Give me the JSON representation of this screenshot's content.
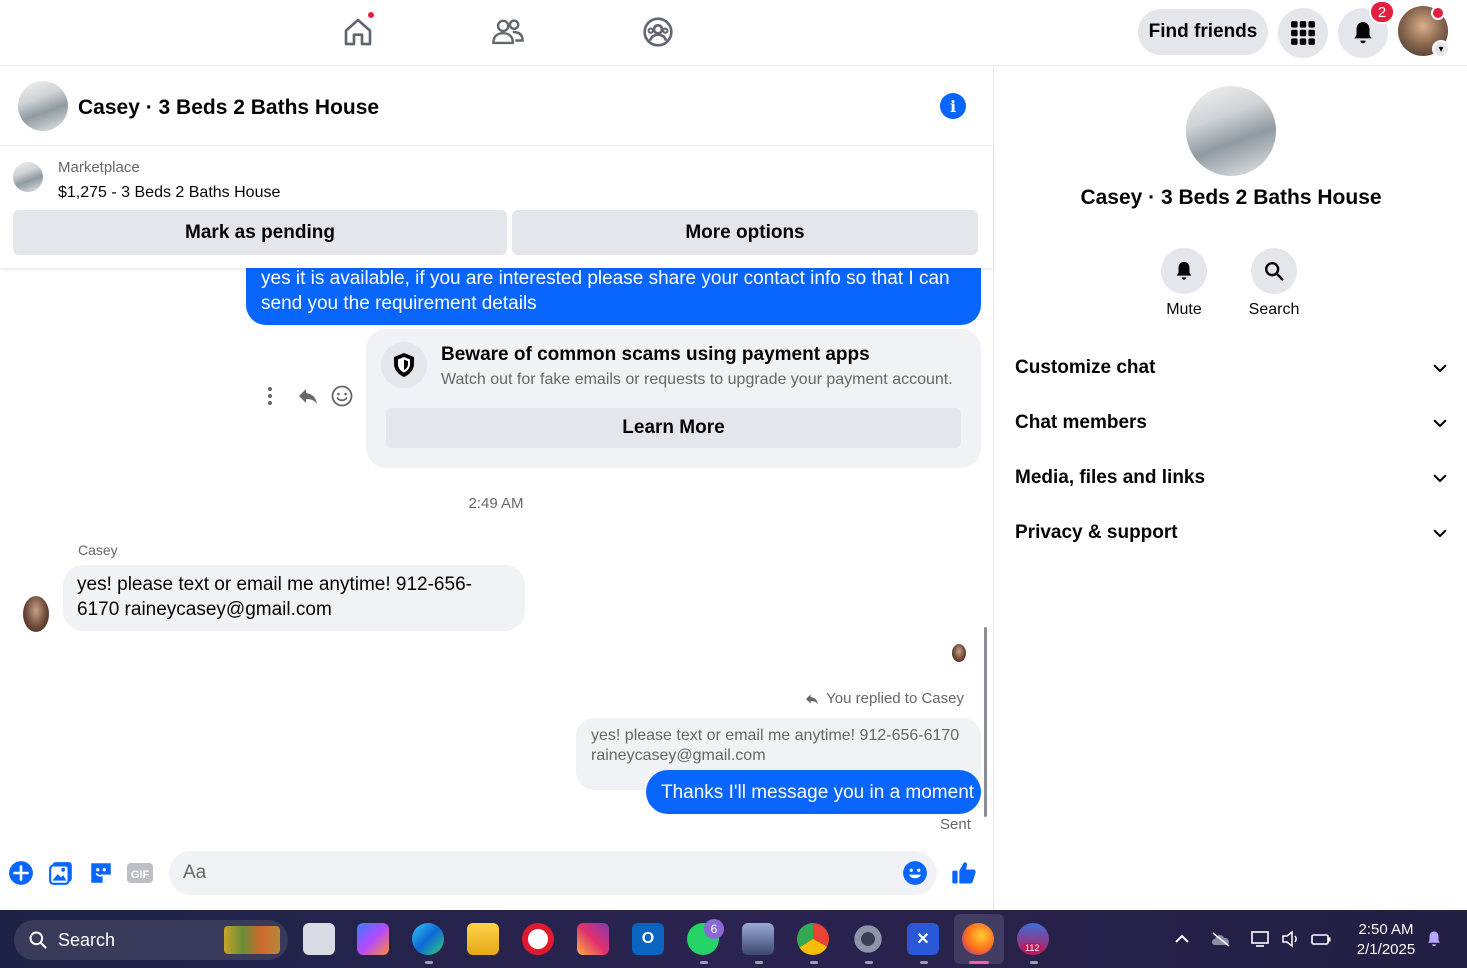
{
  "topbar": {
    "find_friends_label": "Find friends",
    "notification_count": "2"
  },
  "chat": {
    "title": "Casey · 3 Beds 2 Baths House",
    "marketplace_label": "Marketplace",
    "listing": "$1,275 - 3 Beds 2 Baths House",
    "mark_pending_label": "Mark as pending",
    "more_options_label": "More options"
  },
  "messages": {
    "outgoing_1": "yes it is available, if you are interested please share your contact info so that I can send you the requirement details",
    "scam_title": "Beware of common scams using payment apps",
    "scam_subtitle": "Watch out for fake emails or requests to upgrade your payment account.",
    "learn_more_label": "Learn More",
    "timestamp": "2:49 AM",
    "sender": "Casey",
    "incoming_1": "yes! please text or email me anytime! 912-656-6170 raineycasey@gmail.com",
    "replied_label": "You replied to Casey",
    "quoted_text": "yes! please text or email me anytime! 912-656-6170 raineycasey@gmail.com",
    "outgoing_2": "Thanks I'll message you in a moment",
    "status": "Sent"
  },
  "composer": {
    "placeholder": "Aa"
  },
  "right_panel": {
    "title": "Casey · 3 Beds 2 Baths House",
    "mute_label": "Mute",
    "search_label": "Search",
    "sections": [
      "Customize chat",
      "Chat members",
      "Media, files and links",
      "Privacy & support"
    ]
  },
  "taskbar": {
    "search_label": "Search",
    "whatsapp_badge": "6",
    "app_badge": "112",
    "time": "2:50 AM",
    "date": "2/1/2025"
  },
  "colors": {
    "accent": "#0866ff",
    "badge_red": "#e41e3f",
    "bubble_gray": "#f0f2f5"
  }
}
